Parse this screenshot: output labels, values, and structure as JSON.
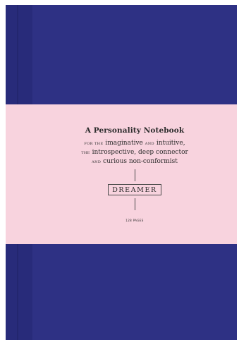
{
  "cover": {
    "title": "A Personality Notebook",
    "line1": {
      "prefix": "for the",
      "word1": "imaginative",
      "connector": "and",
      "word2": "intuitive,"
    },
    "line2": {
      "prefix": "the",
      "text": "introspective, deep connector"
    },
    "line3": {
      "prefix": "and",
      "text": "curious non-conformist"
    },
    "badge": "DREAMER",
    "pages": "128 PAGES"
  },
  "colors": {
    "cover": "#2e3184",
    "spine": "#282b7a",
    "band": "#f8d3de"
  }
}
